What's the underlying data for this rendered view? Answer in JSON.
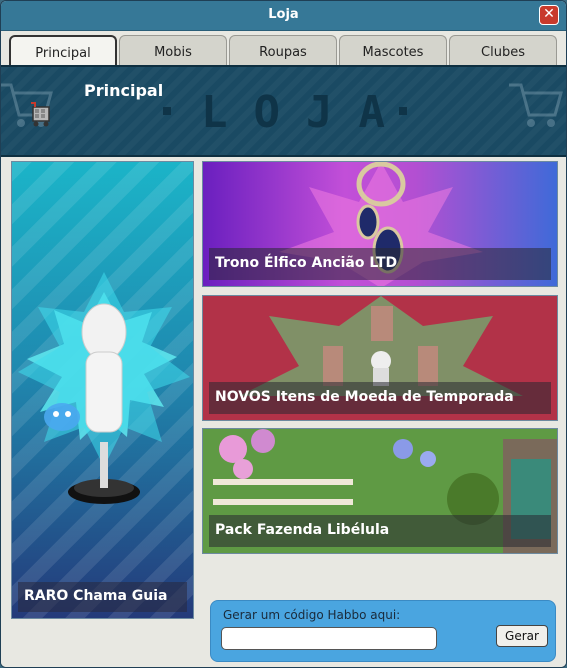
{
  "window": {
    "title": "Loja",
    "close_glyph": "✕"
  },
  "tabs": [
    {
      "label": "Principal",
      "active": true
    },
    {
      "label": "Mobis",
      "active": false
    },
    {
      "label": "Roupas",
      "active": false
    },
    {
      "label": "Mascotes",
      "active": false
    },
    {
      "label": "Clubes",
      "active": false
    }
  ],
  "banner": {
    "page_title": "Principal",
    "loja_text": "LOJA",
    "icon": "shop-cart-icon"
  },
  "featured": {
    "label": "RARO Chama Guia"
  },
  "cards": [
    {
      "label": "Trono Élfico Ancião LTD"
    },
    {
      "label": "NOVOS Itens de Moeda de Temporada"
    },
    {
      "label": "Pack Fazenda Libélula"
    }
  ],
  "code": {
    "label": "Gerar um código Habbo aqui:",
    "value": "",
    "placeholder": "",
    "button_label": "Gerar"
  },
  "colors": {
    "titlebar": "#367897",
    "banner": "#1a4a63",
    "close": "#c83a2c",
    "code_panel": "#4aa5e0"
  }
}
